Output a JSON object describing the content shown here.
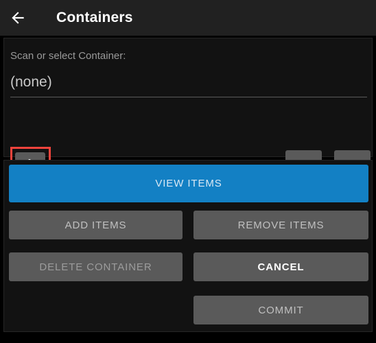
{
  "window": {
    "title": "Containers",
    "back_icon": "arrow-left-icon"
  },
  "selector": {
    "label": "Scan or select Container:",
    "value": "(none)",
    "select_button_icon": "hand-pointer-icon",
    "scroll_down_icon": "circle-arrow-down-icon",
    "scroll_up_icon": "circle-arrow-up-icon",
    "highlight_color": "#f4443c"
  },
  "actions": {
    "view_items": "VIEW ITEMS",
    "add_items": "ADD ITEMS",
    "remove_items": "REMOVE ITEMS",
    "delete_container": "DELETE CONTAINER",
    "cancel": "CANCEL",
    "commit": "COMMIT"
  },
  "colors": {
    "primary": "#1380c4",
    "button": "#5a5a5a",
    "titlebar": "#212121",
    "panel": "#121212"
  }
}
